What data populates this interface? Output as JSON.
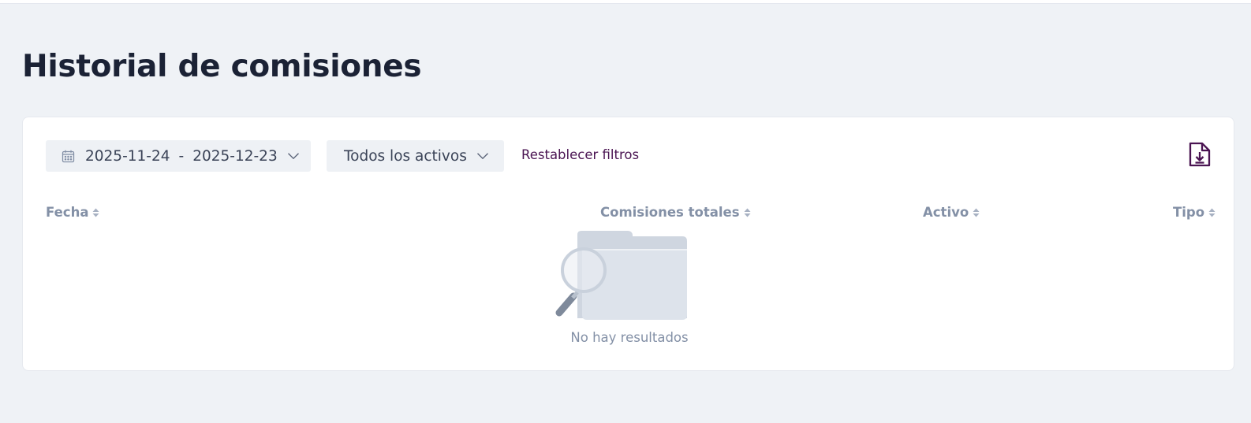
{
  "page": {
    "title": "Historial de comisiones"
  },
  "filters": {
    "date_start": "2025-11-24",
    "date_separator": "-",
    "date_end": "2025-12-23",
    "asset_filter": "Todos los activos",
    "reset_label": "Restablecer filtros"
  },
  "table": {
    "columns": [
      {
        "label": "Fecha"
      },
      {
        "label": "Comisiones totales"
      },
      {
        "label": "Activo"
      },
      {
        "label": "Tipo"
      }
    ],
    "rows": [],
    "empty_text": "No hay resultados"
  },
  "icons": {
    "date": "calendar-icon",
    "dropdown": "chevron-down-icon",
    "export": "file-download-icon",
    "sort": "sort-icon",
    "empty": "folder-search-illustration"
  },
  "colors": {
    "accent": "#4a1452",
    "title": "#1b2235",
    "muted": "#8390a6",
    "background": "#eff2f6"
  }
}
